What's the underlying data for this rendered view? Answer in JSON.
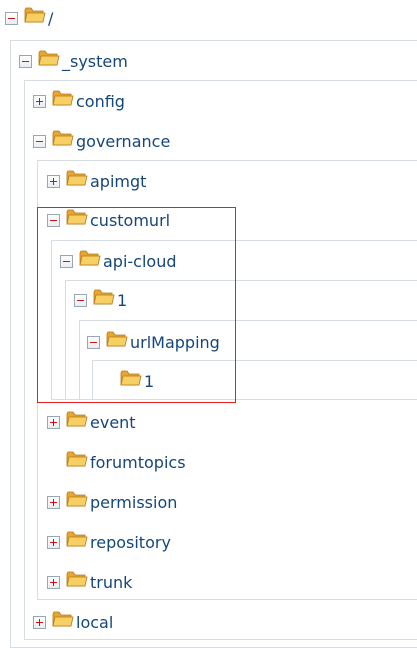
{
  "tree": {
    "root": {
      "label": "/",
      "state": "expanded"
    },
    "system": {
      "label": "_system",
      "state": "expanded"
    },
    "config": {
      "label": "config",
      "state": "collapsed"
    },
    "governance": {
      "label": "governance",
      "state": "expanded"
    },
    "apimgt": {
      "label": "apimgt",
      "state": "collapsed"
    },
    "customurl": {
      "label": "customurl",
      "state": "expanded"
    },
    "api_cloud": {
      "label": "api-cloud",
      "state": "expanded"
    },
    "one": {
      "label": "1",
      "state": "expanded"
    },
    "urlmapping": {
      "label": "urlMapping",
      "state": "expanded"
    },
    "one_leaf": {
      "label": "1",
      "state": "leaf"
    },
    "event": {
      "label": "event",
      "state": "collapsed"
    },
    "forumtopics": {
      "label": "forumtopics",
      "state": "leaf"
    },
    "permission": {
      "label": "permission",
      "state": "collapsed"
    },
    "repository": {
      "label": "repository",
      "state": "collapsed"
    },
    "trunk": {
      "label": "trunk",
      "state": "collapsed"
    },
    "local": {
      "label": "local",
      "state": "collapsed"
    }
  },
  "colors": {
    "link": "#15467a",
    "highlight_border": "#e52020",
    "folder": "#f2b43a",
    "tree_lines": "#d6dde3"
  }
}
